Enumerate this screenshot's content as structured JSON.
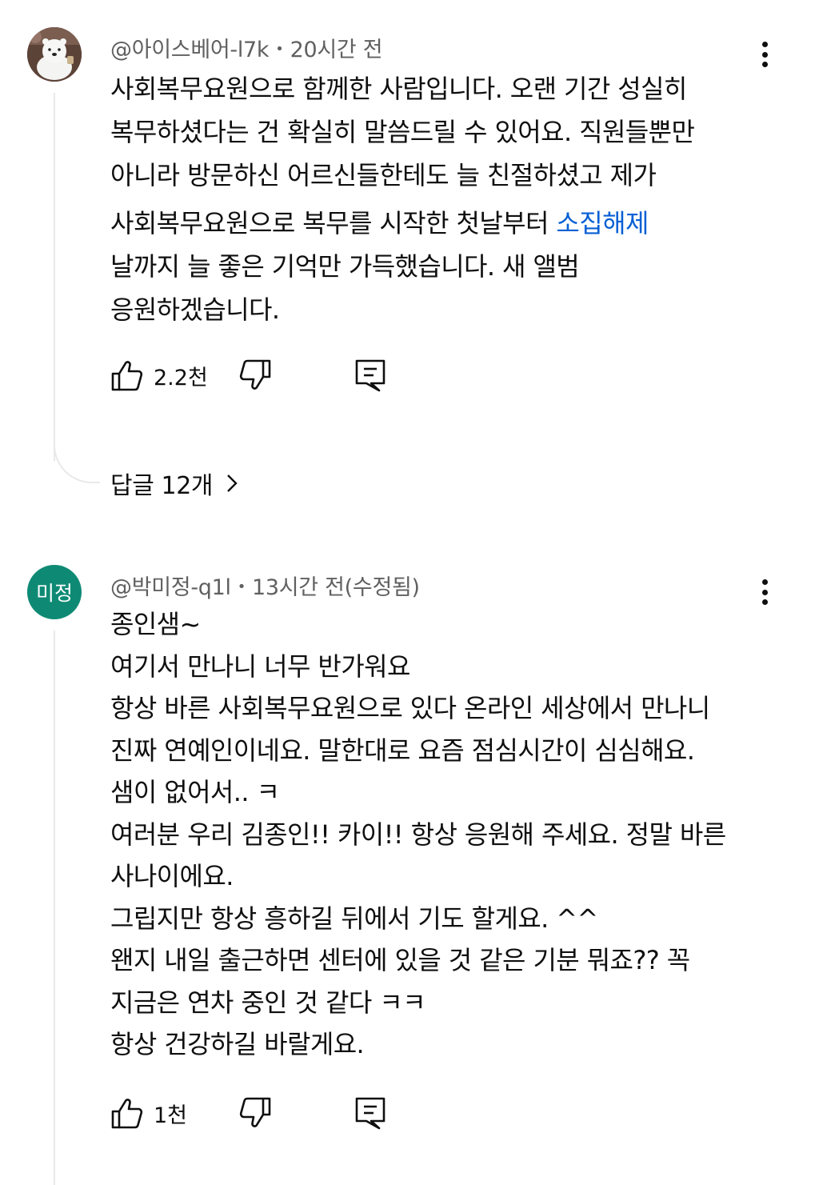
{
  "comments": [
    {
      "author": "@아이스베어-l7k",
      "time": "20시간 전",
      "lines": [
        "사회복무요원으로 함께한 사람입니다. 오랜 기간 성실히",
        "복무하셨다는 건 확실히 말씀드릴 수 있어요. 직원들뿐만",
        "아니라 방문하신 어르신들한테도 늘 친절하셨고 제가"
      ],
      "line4_prefix": "사회복무요원으로 복무를 시작한 첫날부터 ",
      "line4_link": "소집해제",
      "lines_after": [
        "날까지 늘 좋은 기억만 가득했습니다. 새 앨범",
        "응원하겠습니다."
      ],
      "likes": "2.2천",
      "replies_label": "답글 12개"
    },
    {
      "author": "@박미정-q1l",
      "time": "13시간 전(수정됨)",
      "avatar_text": "미정",
      "lines": [
        "종인샘~",
        "여기서 만나니 너무 반가워요",
        "항상 바른 사회복무요원으로 있다 온라인 세상에서 만나니",
        "진짜 연예인이네요. 말한대로 요즘 점심시간이 심심해요.",
        "샘이 없어서.. ㅋ",
        "여러분 우리 김종인!! 카이!! 항상 응원해 주세요. 정말 바른",
        "사나이에요.",
        "그립지만 항상 흥하길 뒤에서 기도 할게요. ^^",
        "왠지 내일 출근하면 센터에 있을 것 같은 기분 뭐죠?? 꼭",
        "지금은 연차 중인 것 같다 ㅋㅋ",
        "항상 건강하길 바랄게요."
      ],
      "likes": "1천"
    }
  ],
  "icons": {
    "like": "thumbs-up-icon",
    "dislike": "thumbs-down-icon",
    "reply": "reply-icon",
    "more": "more-vert-icon",
    "chevron": "chevron-right-icon"
  },
  "colors": {
    "link": "#065fd4",
    "avatar2": "#0e8a74",
    "meta": "#606060"
  }
}
